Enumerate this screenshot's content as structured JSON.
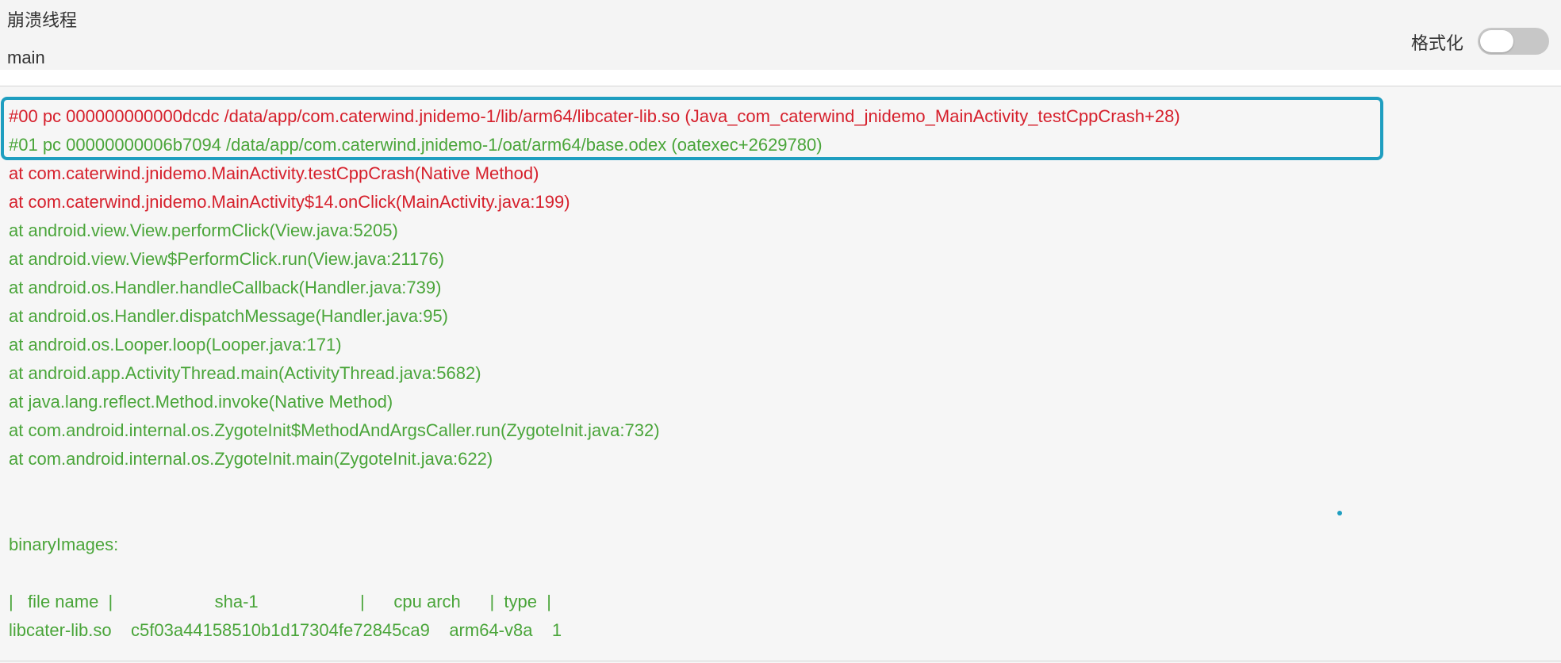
{
  "header": {
    "thread_label": "崩溃线程",
    "thread_name": "main",
    "format_label": "格式化",
    "format_toggle_on": false
  },
  "stack": [
    {
      "text": "#00 pc 000000000000dcdc /data/app/com.caterwind.jnidemo-1/lib/arm64/libcater-lib.so (Java_com_caterwind_jnidemo_MainActivity_testCppCrash+28)",
      "color": "red"
    },
    {
      "text": "#01 pc 00000000006b7094 /data/app/com.caterwind.jnidemo-1/oat/arm64/base.odex (oatexec+2629780)",
      "color": "green"
    },
    {
      "text": "at com.caterwind.jnidemo.MainActivity.testCppCrash(Native Method)",
      "color": "red"
    },
    {
      "text": "at com.caterwind.jnidemo.MainActivity$14.onClick(MainActivity.java:199)",
      "color": "red"
    },
    {
      "text": "at android.view.View.performClick(View.java:5205)",
      "color": "green"
    },
    {
      "text": "at android.view.View$PerformClick.run(View.java:21176)",
      "color": "green"
    },
    {
      "text": "at android.os.Handler.handleCallback(Handler.java:739)",
      "color": "green"
    },
    {
      "text": "at android.os.Handler.dispatchMessage(Handler.java:95)",
      "color": "green"
    },
    {
      "text": "at android.os.Looper.loop(Looper.java:171)",
      "color": "green"
    },
    {
      "text": "at android.app.ActivityThread.main(ActivityThread.java:5682)",
      "color": "green"
    },
    {
      "text": "at java.lang.reflect.Method.invoke(Native Method)",
      "color": "green"
    },
    {
      "text": "at com.android.internal.os.ZygoteInit$MethodAndArgsCaller.run(ZygoteInit.java:732)",
      "color": "green"
    },
    {
      "text": "at com.android.internal.os.ZygoteInit.main(ZygoteInit.java:622)",
      "color": "green"
    }
  ],
  "binary_images": {
    "title": "binaryImages:",
    "header_row": "|   file name  |                     sha-1                     |      cpu arch      |  type  |",
    "rows": [
      "libcater-lib.so    c5f03a44158510b1d17304fe72845ca9    arm64-v8a    1"
    ]
  },
  "colors": {
    "red": "#d6202c",
    "green": "#4aa53a",
    "highlight": "#1f9ec0"
  }
}
